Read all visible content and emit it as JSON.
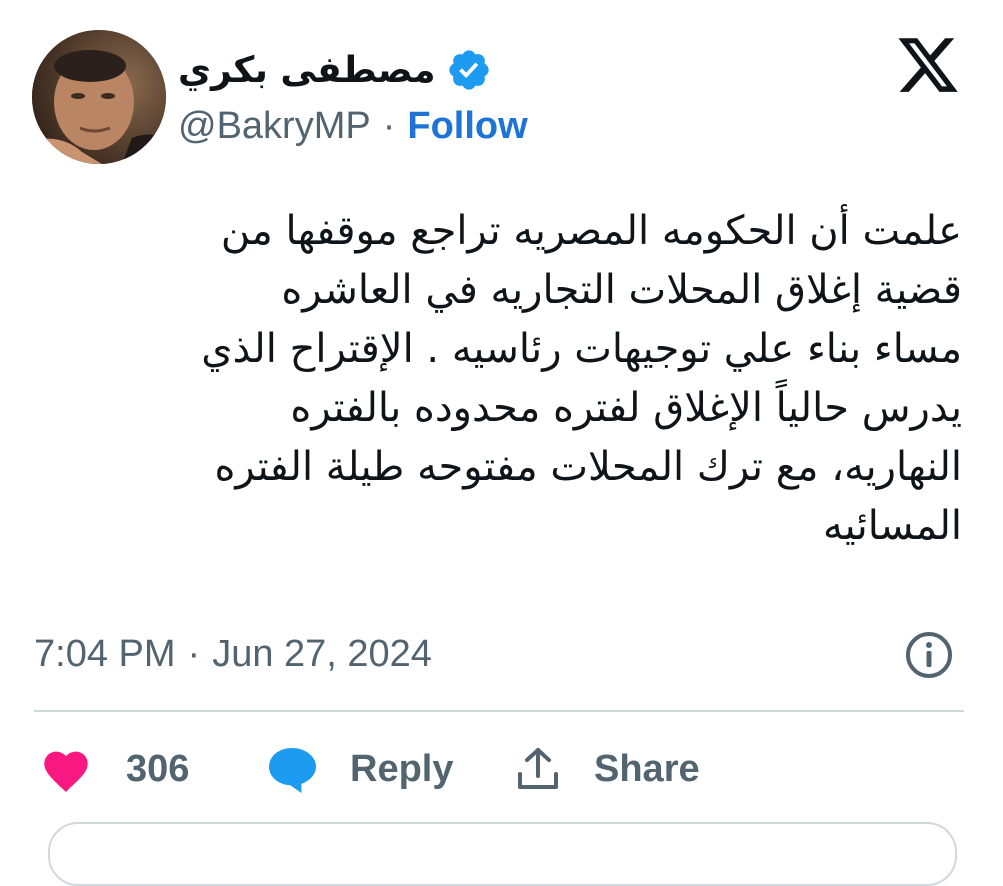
{
  "author": {
    "display_name": "مصطفى بكري",
    "handle": "@BakryMP",
    "separator": "·",
    "follow_label": "Follow",
    "verified": true
  },
  "tweet": {
    "text_lines": [
      "علمت أن الحكومه المصريه تراجع موقفها من",
      "قضية إغلاق المحلات التجاريه في العاشره",
      "مساء بناء علي توجيهات رئاسيه . الإقتراح الذي",
      "يدرس حالياً الإغلاق لفتره محدوده بالفتره",
      "النهاريه، مع ترك المحلات مفتوحه طيلة الفتره",
      "المسائيه"
    ],
    "time": "7:04 PM",
    "separator": "·",
    "date": "Jun 27, 2024"
  },
  "actions": {
    "like_count": "306",
    "reply_label": "Reply",
    "share_label": "Share"
  },
  "icons": {
    "logo": "x-logo-icon",
    "verified": "verified-badge-icon",
    "info": "info-icon",
    "like": "heart-icon",
    "reply": "speech-bubble-icon",
    "share": "share-upload-icon"
  },
  "colors": {
    "link_blue": "#1d74d6",
    "verified_blue": "#1d9bf0",
    "heart_pink": "#f91880",
    "reply_blue": "#1d9bf0",
    "muted_text": "#536471",
    "divider": "#cfd9de"
  }
}
